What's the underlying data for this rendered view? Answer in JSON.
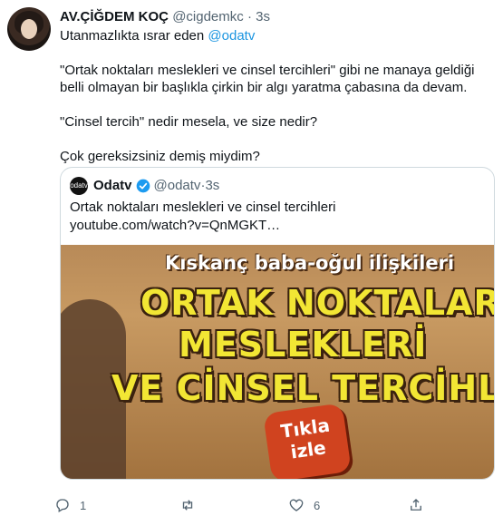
{
  "author": {
    "name": "AV.ÇİĞDEM KOÇ",
    "handle": "@cigdemkc",
    "separator": "·",
    "time": "3s"
  },
  "reply": {
    "prefix": "Utanmazlıkta ısrar eden",
    "mention": "@odatv"
  },
  "body": {
    "p1": "\"Ortak noktaları meslekleri ve cinsel tercihleri\" gibi ne manaya geldiği belli olmayan bir başlıkla çirkin bir algı yaratma çabasına da devam.",
    "p2": "\"Cinsel tercih\" nedir mesela, ve size nedir?",
    "p3": "Çok gereksizsiniz demiş miydim?"
  },
  "quote": {
    "avatar_text": "odatv",
    "name": "Odatv",
    "handle": "@odatv",
    "separator": "·",
    "time": "3s",
    "text": "Ortak noktaları meslekleri ve cinsel tercihleri",
    "url": "youtube.com/watch?v=QnMGKT…",
    "media": {
      "subtitle": "Kıskanç baba-oğul ilişkileri",
      "line1": "ORTAK NOKTALARI",
      "line2": "MESLEKLERİ",
      "line3": "VE CİNSEL TERCİHLERİ",
      "cta_line1": "Tıkla",
      "cta_line2": "izle"
    }
  },
  "actions": {
    "reply_count": "1",
    "retweet_count": "",
    "like_count": "6"
  },
  "colors": {
    "link": "#1b95e0",
    "muted": "#536471",
    "border": "#cfd9de",
    "verified": "#1d9bf0",
    "headline_yellow": "#f2e634",
    "cta_red": "#d0431f"
  }
}
